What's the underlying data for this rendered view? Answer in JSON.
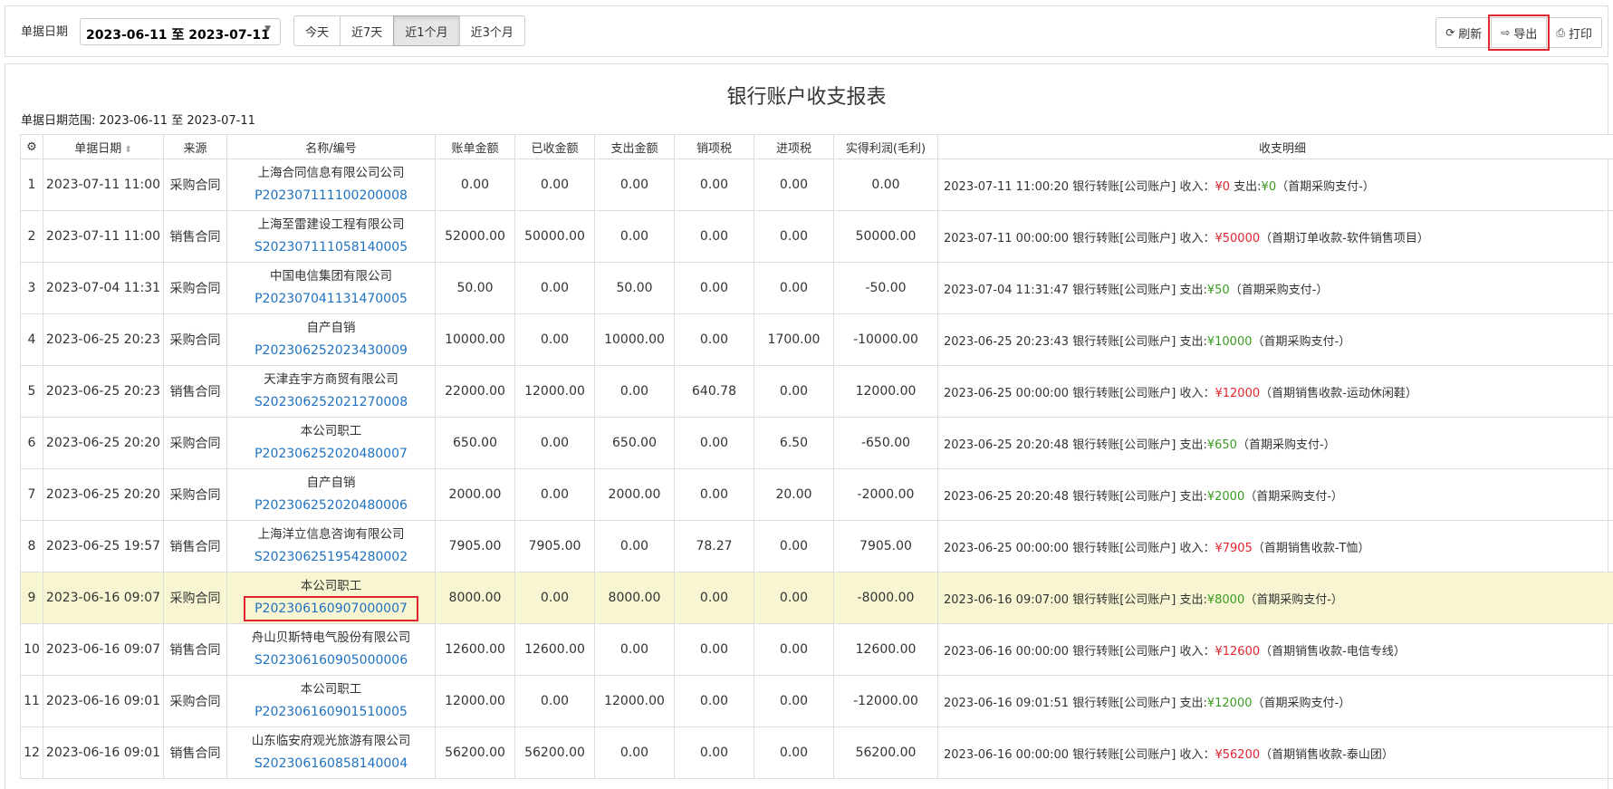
{
  "toolbar": {
    "date_label": "单据日期",
    "date_range": "2023-06-11 至 2023-07-11",
    "quick_ranges": [
      "今天",
      "近7天",
      "近1个月",
      "近3个月"
    ],
    "active_range_index": 2,
    "refresh_label": "刷新",
    "export_label": "导出",
    "print_label": "打印"
  },
  "report": {
    "title": "银行账户收支报表",
    "range_text": "单据日期范围: 2023-06-11 至 2023-07-11"
  },
  "columns": [
    "单据日期",
    "来源",
    "名称/编号",
    "账单金额",
    "已收金额",
    "支出金额",
    "销项税",
    "进项税",
    "实得利润(毛利)",
    "收支明细"
  ],
  "rows": [
    {
      "no": "1",
      "date": "2023-07-11 11:00",
      "source": "采购合同",
      "stype": "buy",
      "name": "上海合同信息有限公司公司",
      "code": "P202307111100200008",
      "bill": "0.00",
      "received": "0.00",
      "paid": "0.00",
      "out_tax": "0.00",
      "in_tax": "0.00",
      "profit": "0.00",
      "detail_prefix": "2023-07-11 11:00:20 银行转账[公司账户]  收入：",
      "detail_amt": "¥0",
      "detail_amt_type": "in",
      "detail_extra": "   支出:",
      "detail_amt2": "¥0",
      "detail_suffix": "（首期采购支付-）"
    },
    {
      "no": "2",
      "date": "2023-07-11 11:00",
      "source": "销售合同",
      "stype": "sell",
      "name": "上海至雷建设工程有限公司",
      "code": "S202307111058140005",
      "bill": "52000.00",
      "received": "50000.00",
      "paid": "0.00",
      "out_tax": "0.00",
      "in_tax": "0.00",
      "profit": "50000.00",
      "detail_prefix": "2023-07-11 00:00:00 银行转账[公司账户]  收入：",
      "detail_amt": "¥50000",
      "detail_amt_type": "in",
      "detail_extra": "",
      "detail_amt2": "",
      "detail_suffix": "（首期订单收款-软件销售项目）"
    },
    {
      "no": "3",
      "date": "2023-07-04 11:31",
      "source": "采购合同",
      "stype": "buy",
      "name": "中国电信集团有限公司",
      "code": "P202307041131470005",
      "bill": "50.00",
      "received": "0.00",
      "paid": "50.00",
      "out_tax": "0.00",
      "in_tax": "0.00",
      "profit": "-50.00",
      "detail_prefix": "2023-07-04 11:31:47 银行转账[公司账户]  支出:",
      "detail_amt": "¥50",
      "detail_amt_type": "out",
      "detail_extra": "",
      "detail_amt2": "",
      "detail_suffix": "（首期采购支付-）"
    },
    {
      "no": "4",
      "date": "2023-06-25 20:23",
      "source": "采购合同",
      "stype": "buy",
      "name": "自产自销",
      "code": "P202306252023430009",
      "bill": "10000.00",
      "received": "0.00",
      "paid": "10000.00",
      "out_tax": "0.00",
      "in_tax": "1700.00",
      "profit": "-10000.00",
      "detail_prefix": "2023-06-25 20:23:43 银行转账[公司账户]  支出:",
      "detail_amt": "¥10000",
      "detail_amt_type": "out",
      "detail_extra": "",
      "detail_amt2": "",
      "detail_suffix": "（首期采购支付-）"
    },
    {
      "no": "5",
      "date": "2023-06-25 20:23",
      "source": "销售合同",
      "stype": "sell",
      "name": "天津垚宇方商贸有限公司",
      "code": "S202306252021270008",
      "bill": "22000.00",
      "received": "12000.00",
      "paid": "0.00",
      "out_tax": "640.78",
      "in_tax": "0.00",
      "profit": "12000.00",
      "detail_prefix": "2023-06-25 00:00:00 银行转账[公司账户]  收入：",
      "detail_amt": "¥12000",
      "detail_amt_type": "in",
      "detail_extra": "",
      "detail_amt2": "",
      "detail_suffix": "（首期销售收款-运动休闲鞋）"
    },
    {
      "no": "6",
      "date": "2023-06-25 20:20",
      "source": "采购合同",
      "stype": "buy",
      "name": "本公司职工",
      "code": "P202306252020480007",
      "bill": "650.00",
      "received": "0.00",
      "paid": "650.00",
      "out_tax": "0.00",
      "in_tax": "6.50",
      "profit": "-650.00",
      "detail_prefix": "2023-06-25 20:20:48 银行转账[公司账户]  支出:",
      "detail_amt": "¥650",
      "detail_amt_type": "out",
      "detail_extra": "",
      "detail_amt2": "",
      "detail_suffix": "（首期采购支付-）"
    },
    {
      "no": "7",
      "date": "2023-06-25 20:20",
      "source": "采购合同",
      "stype": "buy",
      "name": "自产自销",
      "code": "P202306252020480006",
      "bill": "2000.00",
      "received": "0.00",
      "paid": "2000.00",
      "out_tax": "0.00",
      "in_tax": "20.00",
      "profit": "-2000.00",
      "detail_prefix": "2023-06-25 20:20:48 银行转账[公司账户]  支出:",
      "detail_amt": "¥2000",
      "detail_amt_type": "out",
      "detail_extra": "",
      "detail_amt2": "",
      "detail_suffix": "（首期采购支付-）"
    },
    {
      "no": "8",
      "date": "2023-06-25 19:57",
      "source": "销售合同",
      "stype": "sell",
      "name": "上海洋立信息咨询有限公司",
      "code": "S202306251954280002",
      "bill": "7905.00",
      "received": "7905.00",
      "paid": "0.00",
      "out_tax": "78.27",
      "in_tax": "0.00",
      "profit": "7905.00",
      "detail_prefix": "2023-06-25 00:00:00 银行转账[公司账户]  收入：",
      "detail_amt": "¥7905",
      "detail_amt_type": "in",
      "detail_extra": "",
      "detail_amt2": "",
      "detail_suffix": "（首期销售收款-T恤）"
    },
    {
      "no": "9",
      "date": "2023-06-16 09:07",
      "source": "采购合同",
      "stype": "buy",
      "name": "本公司职工",
      "code": "P202306160907000007",
      "bill": "8000.00",
      "received": "0.00",
      "paid": "8000.00",
      "out_tax": "0.00",
      "in_tax": "0.00",
      "profit": "-8000.00",
      "detail_prefix": "2023-06-16 09:07:00 银行转账[公司账户]  支出:",
      "detail_amt": "¥8000",
      "detail_amt_type": "out",
      "detail_extra": "",
      "detail_amt2": "",
      "detail_suffix": "（首期采购支付-）"
    },
    {
      "no": "10",
      "date": "2023-06-16 09:07",
      "source": "销售合同",
      "stype": "sell",
      "name": "舟山贝斯特电气股份有限公司",
      "code": "S202306160905000006",
      "bill": "12600.00",
      "received": "12600.00",
      "paid": "0.00",
      "out_tax": "0.00",
      "in_tax": "0.00",
      "profit": "12600.00",
      "detail_prefix": "2023-06-16 00:00:00 银行转账[公司账户]  收入：",
      "detail_amt": "¥12600",
      "detail_amt_type": "in",
      "detail_extra": "",
      "detail_amt2": "",
      "detail_suffix": "（首期销售收款-电信专线）"
    },
    {
      "no": "11",
      "date": "2023-06-16 09:01",
      "source": "采购合同",
      "stype": "buy",
      "name": "本公司职工",
      "code": "P202306160901510005",
      "bill": "12000.00",
      "received": "0.00",
      "paid": "12000.00",
      "out_tax": "0.00",
      "in_tax": "0.00",
      "profit": "-12000.00",
      "detail_prefix": "2023-06-16 09:01:51 银行转账[公司账户]  支出:",
      "detail_amt": "¥12000",
      "detail_amt_type": "out",
      "detail_extra": "",
      "detail_amt2": "",
      "detail_suffix": "（首期采购支付-）"
    },
    {
      "no": "12",
      "date": "2023-06-16 09:01",
      "source": "销售合同",
      "stype": "sell",
      "name": "山东临安府观光旅游有限公司",
      "code": "S202306160858140004",
      "bill": "56200.00",
      "received": "56200.00",
      "paid": "0.00",
      "out_tax": "0.00",
      "in_tax": "0.00",
      "profit": "56200.00",
      "detail_prefix": "2023-06-16 00:00:00 银行转账[公司账户]  收入：",
      "detail_amt": "¥56200",
      "detail_amt_type": "in",
      "detail_extra": "",
      "detail_amt2": "",
      "detail_suffix": "（首期销售收款-泰山团）"
    }
  ],
  "highlight_row_index": 8
}
